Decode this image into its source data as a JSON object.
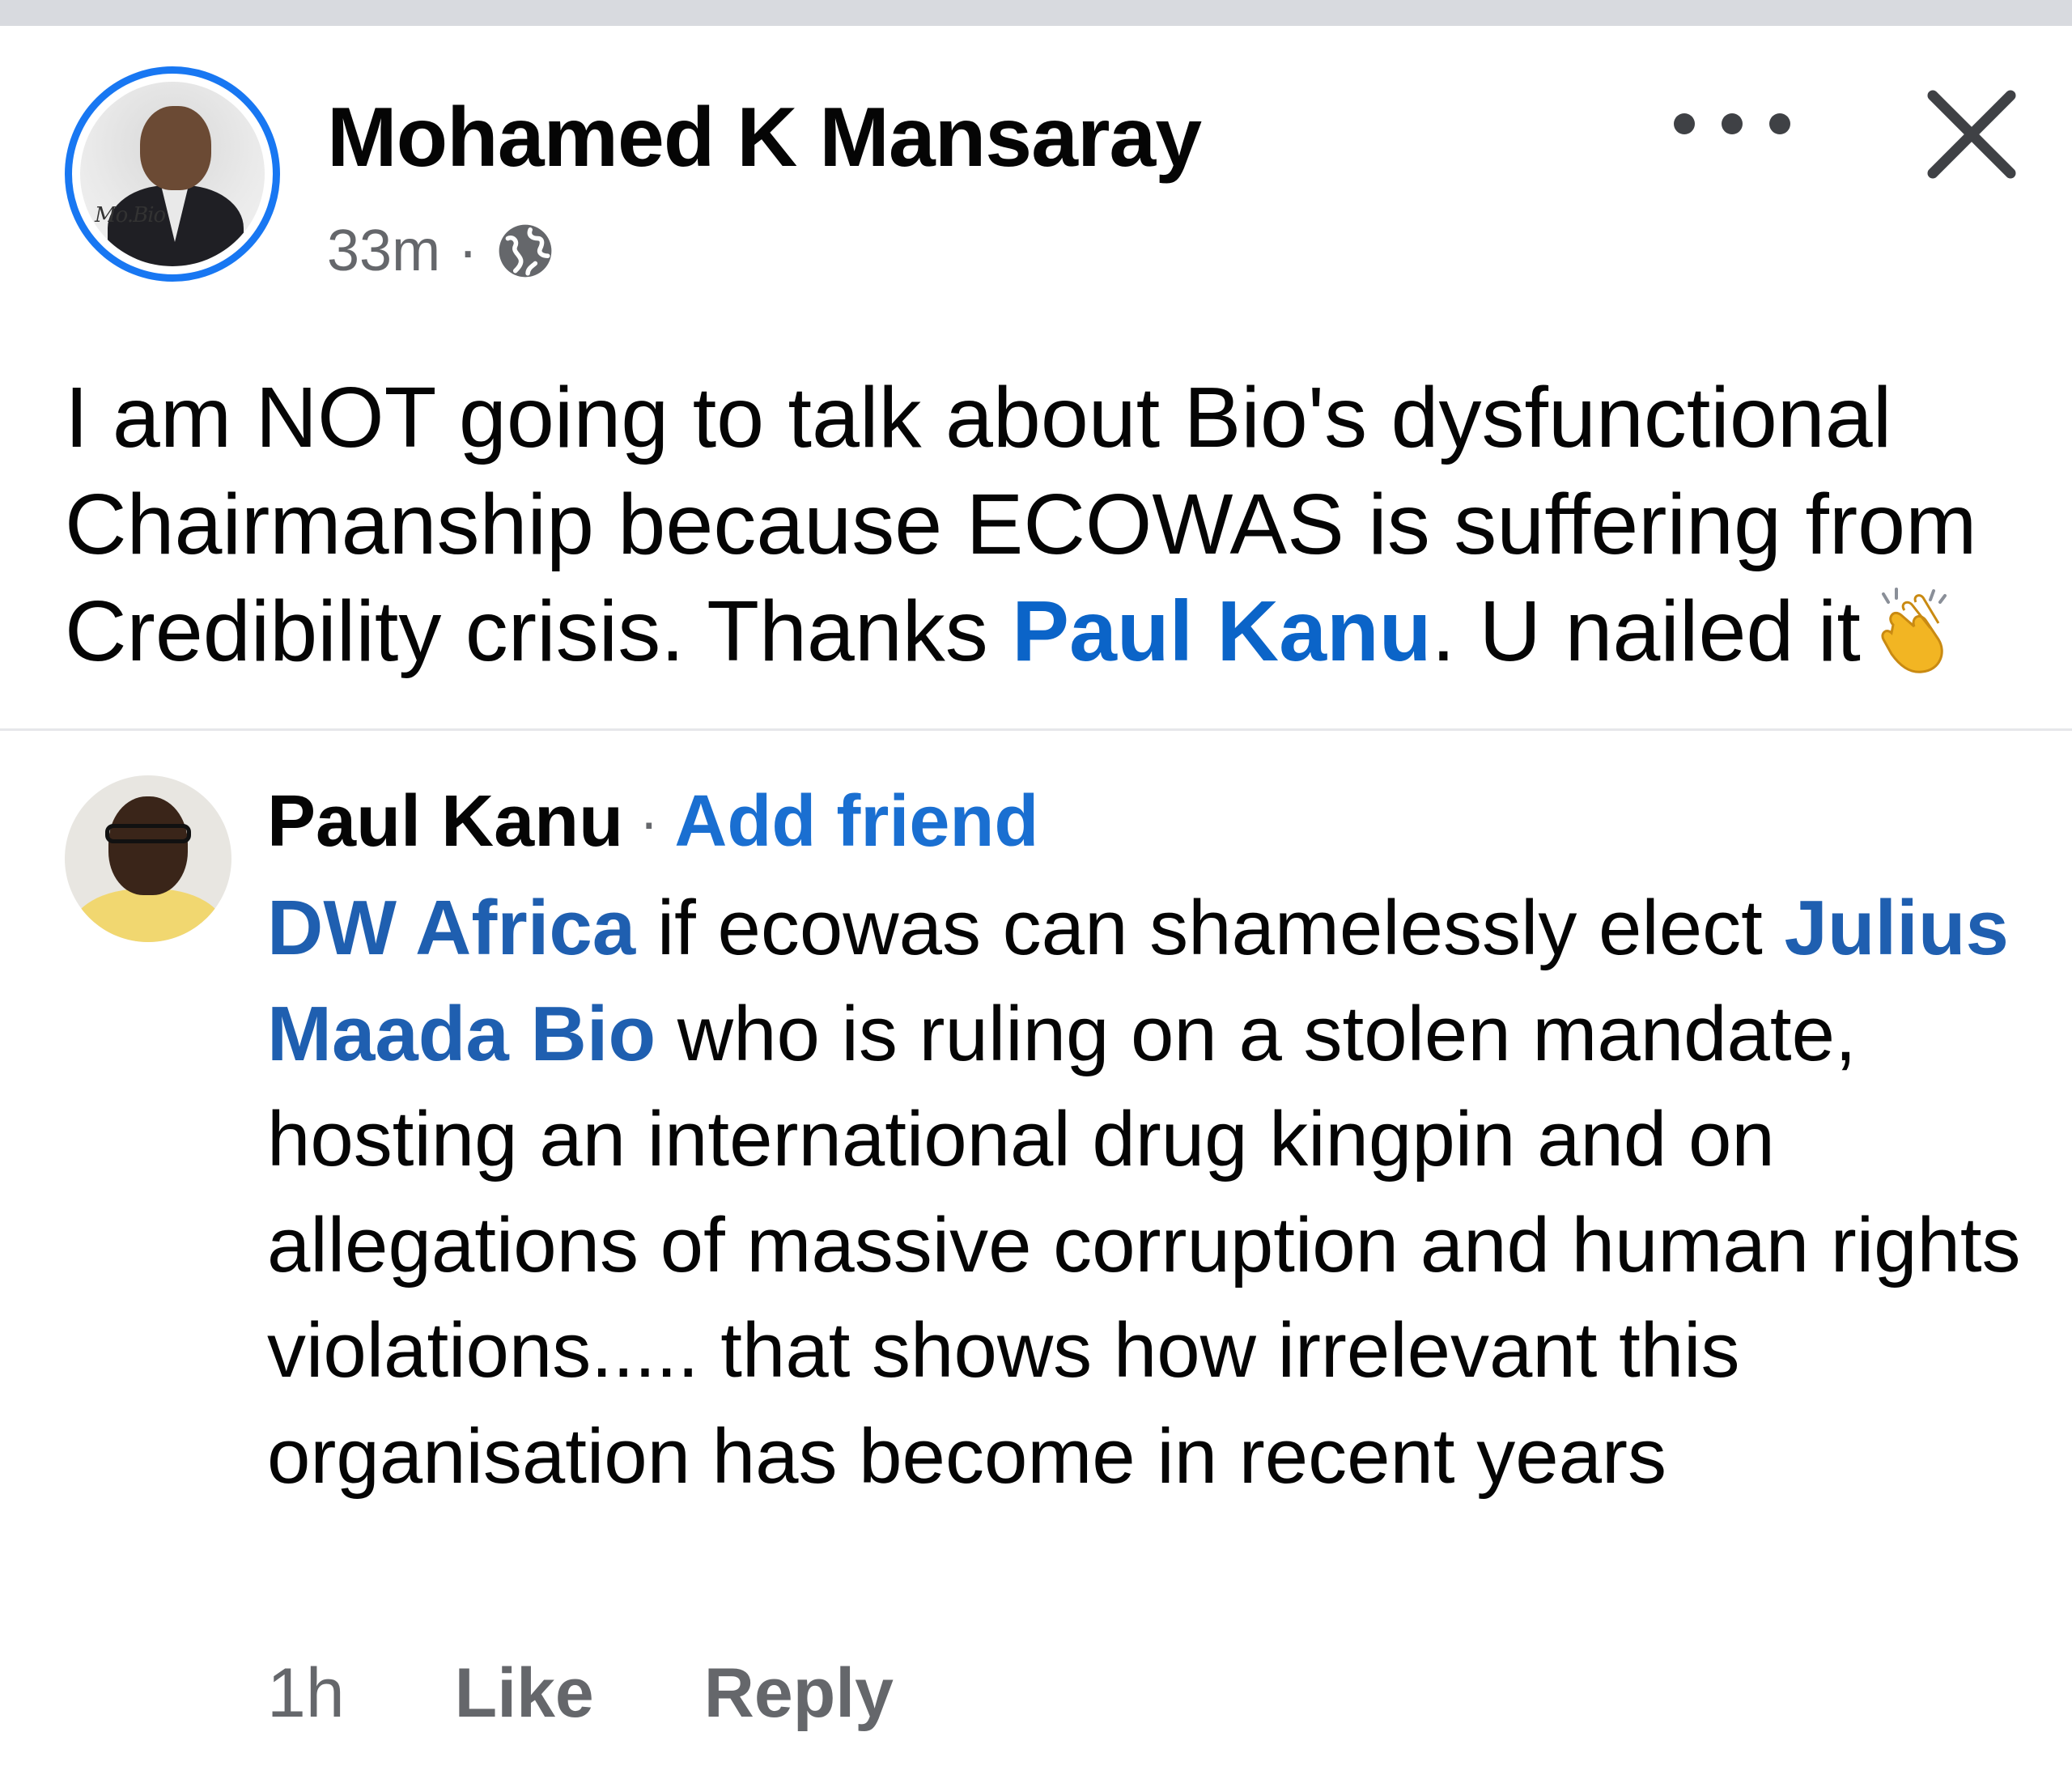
{
  "post": {
    "author": "Mohamed K Mansaray",
    "time": "33m",
    "separator": "·",
    "privacy_icon": "globe-icon",
    "avatar_signature": "Mo.Bio",
    "text_part1": "I am NOT going to talk about Bio's dysfunctional Chairmanship because ECOWAS is suffering from Credibility crisis. Thanks ",
    "mention": "Paul Kanu",
    "text_part2": ". U nailed it",
    "emoji": "clapping-hands-icon"
  },
  "header_actions": {
    "more_icon": "more-options-icon",
    "close_icon": "close-icon"
  },
  "comment": {
    "author": "Paul Kanu",
    "separator": "·",
    "add_friend": "Add friend",
    "mention1": "DW Africa",
    "text1": " if ecowas can shamelessly elect ",
    "mention2": "Julius Maada Bio",
    "text2": " who is ruling on a stolen mandate, hosting an international drug kingpin and on allegations of massive corruption and human rights violations..... that shows how irrelevant this organisation has become in recent years",
    "time": "1h",
    "like": "Like",
    "reply": "Reply"
  },
  "colors": {
    "accent_blue": "#1877f2",
    "mention_blue": "#0b64c8",
    "muted_gray": "#65676b"
  }
}
